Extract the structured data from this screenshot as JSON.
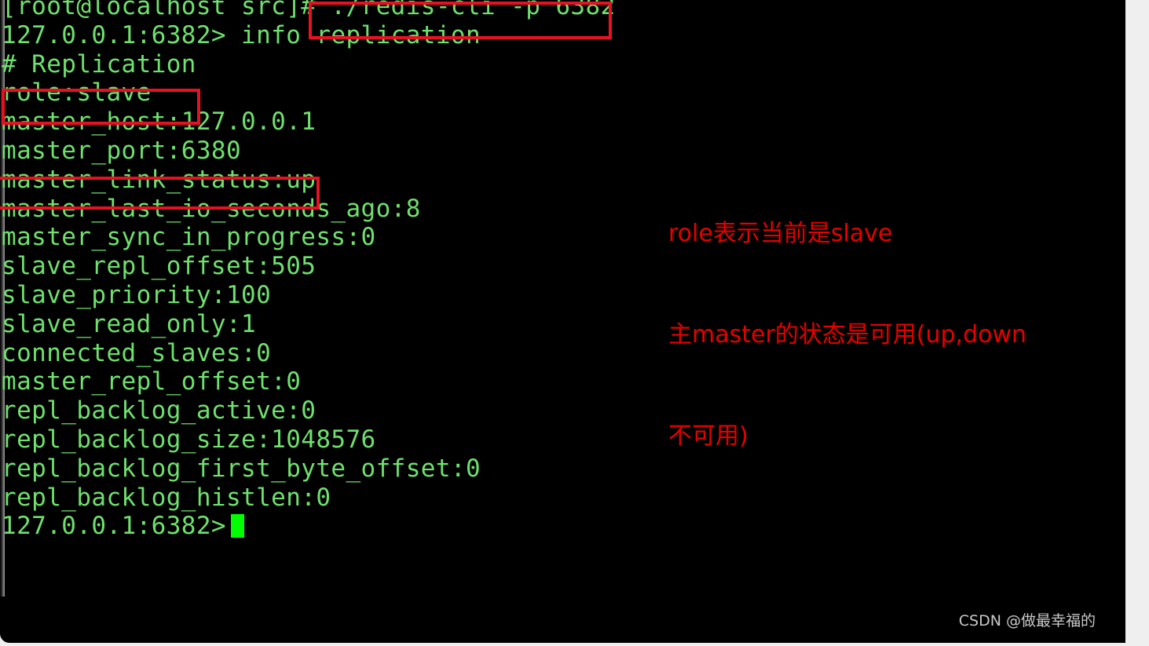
{
  "terminal": {
    "background_color": "#000000",
    "text_color": "#6ee06e",
    "cursor_color": "#00ff00",
    "lines": [
      "[root@localhost src]# ./redis-cli -p 6382",
      "127.0.0.1:6382> info replication",
      "# Replication",
      "role:slave",
      "master_host:127.0.0.1",
      "master_port:6380",
      "master_link_status:up",
      "master_last_io_seconds_ago:8",
      "master_sync_in_progress:0",
      "slave_repl_offset:505",
      "slave_priority:100",
      "slave_read_only:1",
      "connected_slaves:0",
      "master_repl_offset:0",
      "repl_backlog_active:0",
      "repl_backlog_size:1048576",
      "repl_backlog_first_byte_offset:0",
      "repl_backlog_histlen:0"
    ],
    "prompt": "127.0.0.1:6382>",
    "shell_prompt": "[root@localhost src]#",
    "command": "./redis-cli -p 6382",
    "redis_command": "info replication",
    "section_header": "# Replication"
  },
  "highlights": {
    "color": "#e81123",
    "boxes": [
      {
        "target": "command",
        "label": "./redis-cli -p 6382"
      },
      {
        "target": "role",
        "label": "role:slave"
      },
      {
        "target": "link_status",
        "label": "master_link_status:up"
      }
    ]
  },
  "annotation": {
    "color": "#e60000",
    "lines": [
      "role表示当前是slave",
      "主master的状态是可用(up,down",
      "不可用)"
    ]
  },
  "watermark": {
    "text": "CSDN @做最幸福的"
  },
  "scrollbar": {
    "thumb_color": "#878787",
    "track_color": "#efefef"
  }
}
